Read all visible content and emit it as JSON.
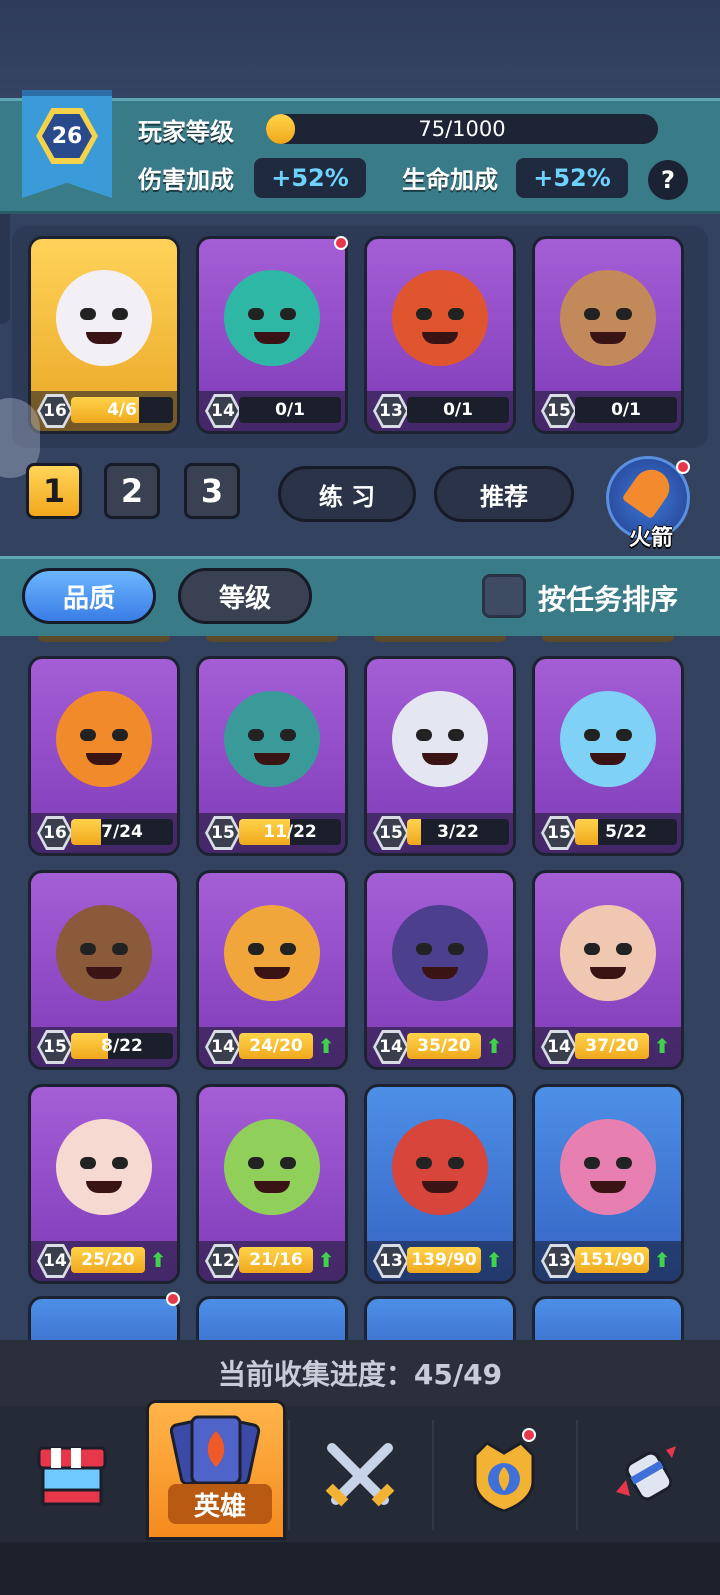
{
  "player": {
    "level": "26",
    "level_label": "玩家等级",
    "xp_text": "75/1000",
    "xp_fraction": 0.075,
    "damage_label": "伤害加成",
    "damage_value": "+52%",
    "hp_label": "生命加成",
    "hp_value": "+52%",
    "help": "?"
  },
  "team": [
    {
      "level": "16",
      "progress": "4/6",
      "fill": 0.67,
      "rarity": "gold",
      "art_color": "#f2f0f6",
      "dot": false
    },
    {
      "level": "14",
      "progress": "0/1",
      "fill": 0,
      "rarity": "purple",
      "art_color": "#2fb7a5",
      "dot": true
    },
    {
      "level": "13",
      "progress": "0/1",
      "fill": 0,
      "rarity": "purple",
      "art_color": "#e0552e",
      "dot": false
    },
    {
      "level": "15",
      "progress": "0/1",
      "fill": 0,
      "rarity": "purple",
      "art_color": "#c28a5a",
      "dot": false
    }
  ],
  "team_buttons": [
    "1",
    "2",
    "3"
  ],
  "practice_label": "练 习",
  "recommend_label": "推荐",
  "rocket_label": "火箭",
  "sort": {
    "quality_label": "品质",
    "level_label": "等级",
    "task_label": "按任务排序"
  },
  "heroes": [
    {
      "level": "16",
      "progress": "7/24",
      "fill": 0.29,
      "rarity": "purple",
      "art_color": "#f08a2a",
      "up": false
    },
    {
      "level": "15",
      "progress": "11/22",
      "fill": 0.5,
      "rarity": "purple",
      "art_color": "#3a9a9a",
      "up": false
    },
    {
      "level": "15",
      "progress": "3/22",
      "fill": 0.14,
      "rarity": "purple",
      "art_color": "#e4e6f2",
      "up": false
    },
    {
      "level": "15",
      "progress": "5/22",
      "fill": 0.23,
      "rarity": "purple",
      "art_color": "#7fd2f5",
      "up": false
    },
    {
      "level": "15",
      "progress": "8/22",
      "fill": 0.36,
      "rarity": "purple",
      "art_color": "#8a5a3a",
      "up": false
    },
    {
      "level": "14",
      "progress": "24/20",
      "fill": 1,
      "rarity": "purple",
      "art_color": "#f0a63a",
      "up": true
    },
    {
      "level": "14",
      "progress": "35/20",
      "fill": 1,
      "rarity": "purple",
      "art_color": "#4b3f8e",
      "up": true
    },
    {
      "level": "14",
      "progress": "37/20",
      "fill": 1,
      "rarity": "purple",
      "art_color": "#f0c7b0",
      "up": true
    },
    {
      "level": "14",
      "progress": "25/20",
      "fill": 1,
      "rarity": "purple",
      "art_color": "#f6d9d0",
      "up": true
    },
    {
      "level": "12",
      "progress": "21/16",
      "fill": 1,
      "rarity": "purple",
      "art_color": "#8fcf5a",
      "up": true
    },
    {
      "level": "13",
      "progress": "139/90",
      "fill": 1,
      "rarity": "blue",
      "art_color": "#d8453a",
      "up": true
    },
    {
      "level": "13",
      "progress": "151/90",
      "fill": 1,
      "rarity": "blue",
      "art_color": "#e77fb0",
      "up": true
    }
  ],
  "collection": {
    "label": "当前收集进度：45/49"
  },
  "nav": [
    {
      "name": "shop-icon",
      "label": ""
    },
    {
      "name": "hero-tab",
      "label": "英雄"
    },
    {
      "name": "battle-swords-icon",
      "label": ""
    },
    {
      "name": "crown-shield-icon",
      "label": ""
    },
    {
      "name": "rocket-fist-icon",
      "label": ""
    }
  ]
}
